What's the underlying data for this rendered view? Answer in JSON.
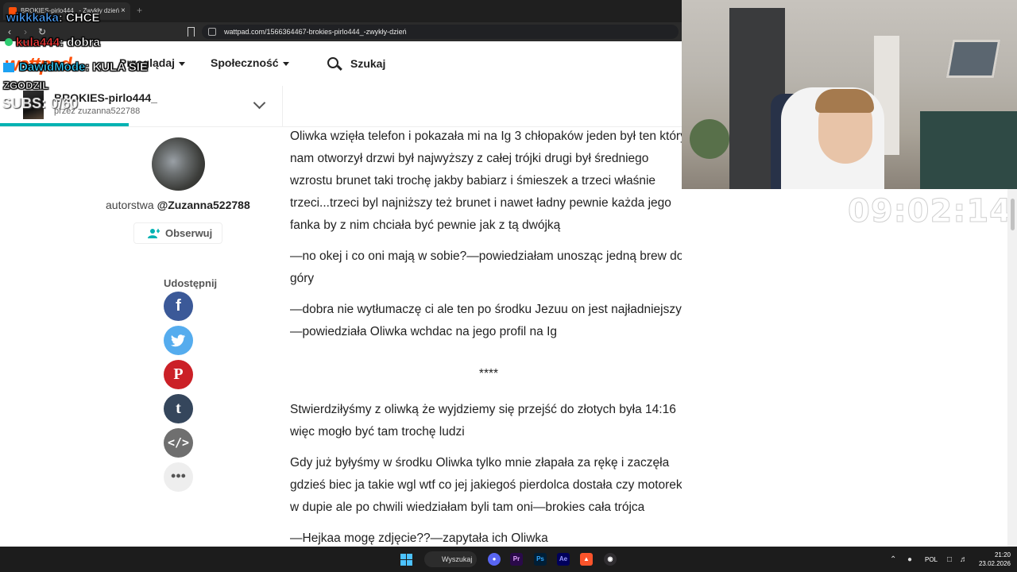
{
  "browser": {
    "tab_title": "BROKIES-pirlo444_ - Zwykły dzień",
    "url": "wattpad.com/1566364467-brokies-pirlo444_-zwykły-dzień",
    "tab_close": "×",
    "new_tab": "+"
  },
  "header": {
    "logo": "wattpad",
    "browse": "Przeglądaj",
    "community": "Społeczność",
    "search": "Szukaj"
  },
  "story": {
    "title": "BROKIES-pirlo444_",
    "author": "przez zuzanna522788"
  },
  "sidebar": {
    "author_prefix": "autorstwa",
    "author_handle": "@Zuzanna522788",
    "follow": "Obserwuj",
    "share_label": "Udostępnij",
    "share_icons": [
      "facebook-icon",
      "twitter-icon",
      "pinterest-icon",
      "tumblr-icon",
      "embed-icon",
      "more-icon"
    ]
  },
  "content": {
    "paragraphs": [
      "Oliwka wzięła telefon i pokazała mi na Ig 3 chłopaków jeden był ten który nam otworzył drzwi był najwyższy z całej trójki drugi był średniego wzrostu brunet taki trochę jakby babiarz i śmieszek a trzeci właśnie trzeci...trzeci byl najniższy też brunet i nawet ładny pewnie każda jego fanka by z nim chciała być pewnie jak z tą dwójką",
      "—no okej i co oni mają w sobie?—powiedziałam unosząc jedną brew do góry",
      "—dobra nie wytłumaczę ci ale ten po środku Jezuu on jest najładniejszy—powiedziała Oliwka wchdac na jego profil na Ig",
      "****",
      "Stwierdziłyśmy z oliwką że wyjdziemy się przejść do złotych była 14:16 więc mogło być tam trochę ludzi",
      "Gdy już byłyśmy w środku Oliwka tylko mnie złapała za rękę i zaczęła gdzieś biec ja takie wgl wtf co jej jakiegoś pierdolca dostała czy motorek w dupie ale po chwili wiedziałam byli tam oni—brokies cała trójca",
      "—Hejkaa mogę zdjęcie??—zapytała ich Oliwka"
    ]
  },
  "chat": {
    "line1_user": "wikkkaka",
    "line1_msg": ": CHCE",
    "line2_user": "kula444",
    "line2_msg": ": dobra",
    "line3_user": "DawidMode",
    "line3_msg": ": KULA SIE",
    "line4_msg": "ZGODZIL",
    "subs": "SUBS: 0/60"
  },
  "overlay": {
    "clock": "09:02:14"
  },
  "taskbar": {
    "search": "Wyszukaj",
    "lang": "POL",
    "time": "21:20",
    "date": "23.02.2026",
    "apps": [
      "discord-icon",
      "premiere-icon",
      "photoshop-icon",
      "after-effects-icon",
      "brave-icon",
      "obs-icon"
    ]
  },
  "colors": {
    "brand": "#ff500a",
    "progress": "#00b2b2",
    "facebook": "#3b5998",
    "twitter": "#55acee",
    "pinterest": "#cb2027",
    "tumblr": "#35465c",
    "embed": "#6f6f6f"
  }
}
